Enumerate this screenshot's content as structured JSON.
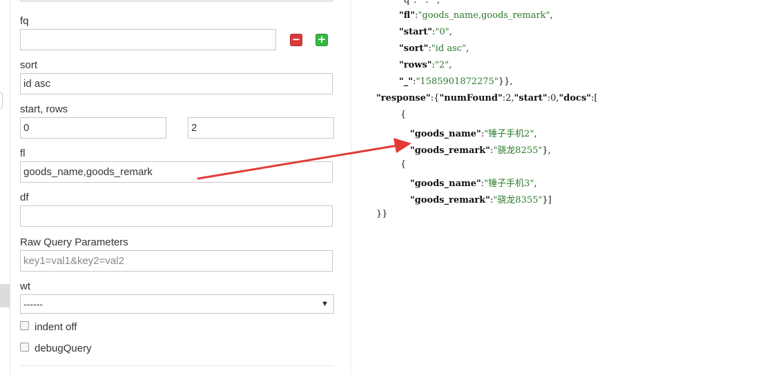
{
  "form": {
    "fq": {
      "label": "fq",
      "value": ""
    },
    "sort": {
      "label": "sort",
      "value": "id asc"
    },
    "start_rows": {
      "label": "start, rows",
      "start": "0",
      "rows": "2"
    },
    "fl": {
      "label": "fl",
      "value": "goods_name,goods_remark"
    },
    "df": {
      "label": "df",
      "value": ""
    },
    "raw": {
      "label": "Raw Query Parameters",
      "placeholder": "key1=val1&key2=val2"
    },
    "wt": {
      "label": "wt",
      "selected": "------"
    },
    "indent": {
      "label": "indent off"
    },
    "debug": {
      "label": "debugQuery"
    }
  },
  "response": {
    "line_q": "\"q\":\"*:*\",",
    "fl_key": "\"fl\"",
    "fl_val": "\"goods_name,goods_remark\"",
    "start_key": "\"start\"",
    "start_val": "\"0\"",
    "sort_key": "\"sort\"",
    "sort_val": "\"id asc\"",
    "rows_key": "\"rows\"",
    "rows_val": "\"2\"",
    "ts_key": "\"_\"",
    "ts_val": "\"1585901872275\"",
    "response_key": "\"response\"",
    "numfound_key": "\"numFound\"",
    "numfound_val": "2",
    "startk": "\"start\"",
    "startv": "0",
    "docs_key": "\"docs\"",
    "docs": [
      {
        "name_key": "\"goods_name\"",
        "name_val": "\"锤子手机2\"",
        "remark_key": "\"goods_remark\"",
        "remark_val": "\"骁龙8255\""
      },
      {
        "name_key": "\"goods_name\"",
        "name_val": "\"锤子手机3\"",
        "remark_key": "\"goods_remark\"",
        "remark_val": "\"骁龙8355\""
      }
    ]
  },
  "colors": {
    "annotation_arrow": "#e53935",
    "remove_button": "#d93a3a",
    "add_button": "#36b83e"
  }
}
